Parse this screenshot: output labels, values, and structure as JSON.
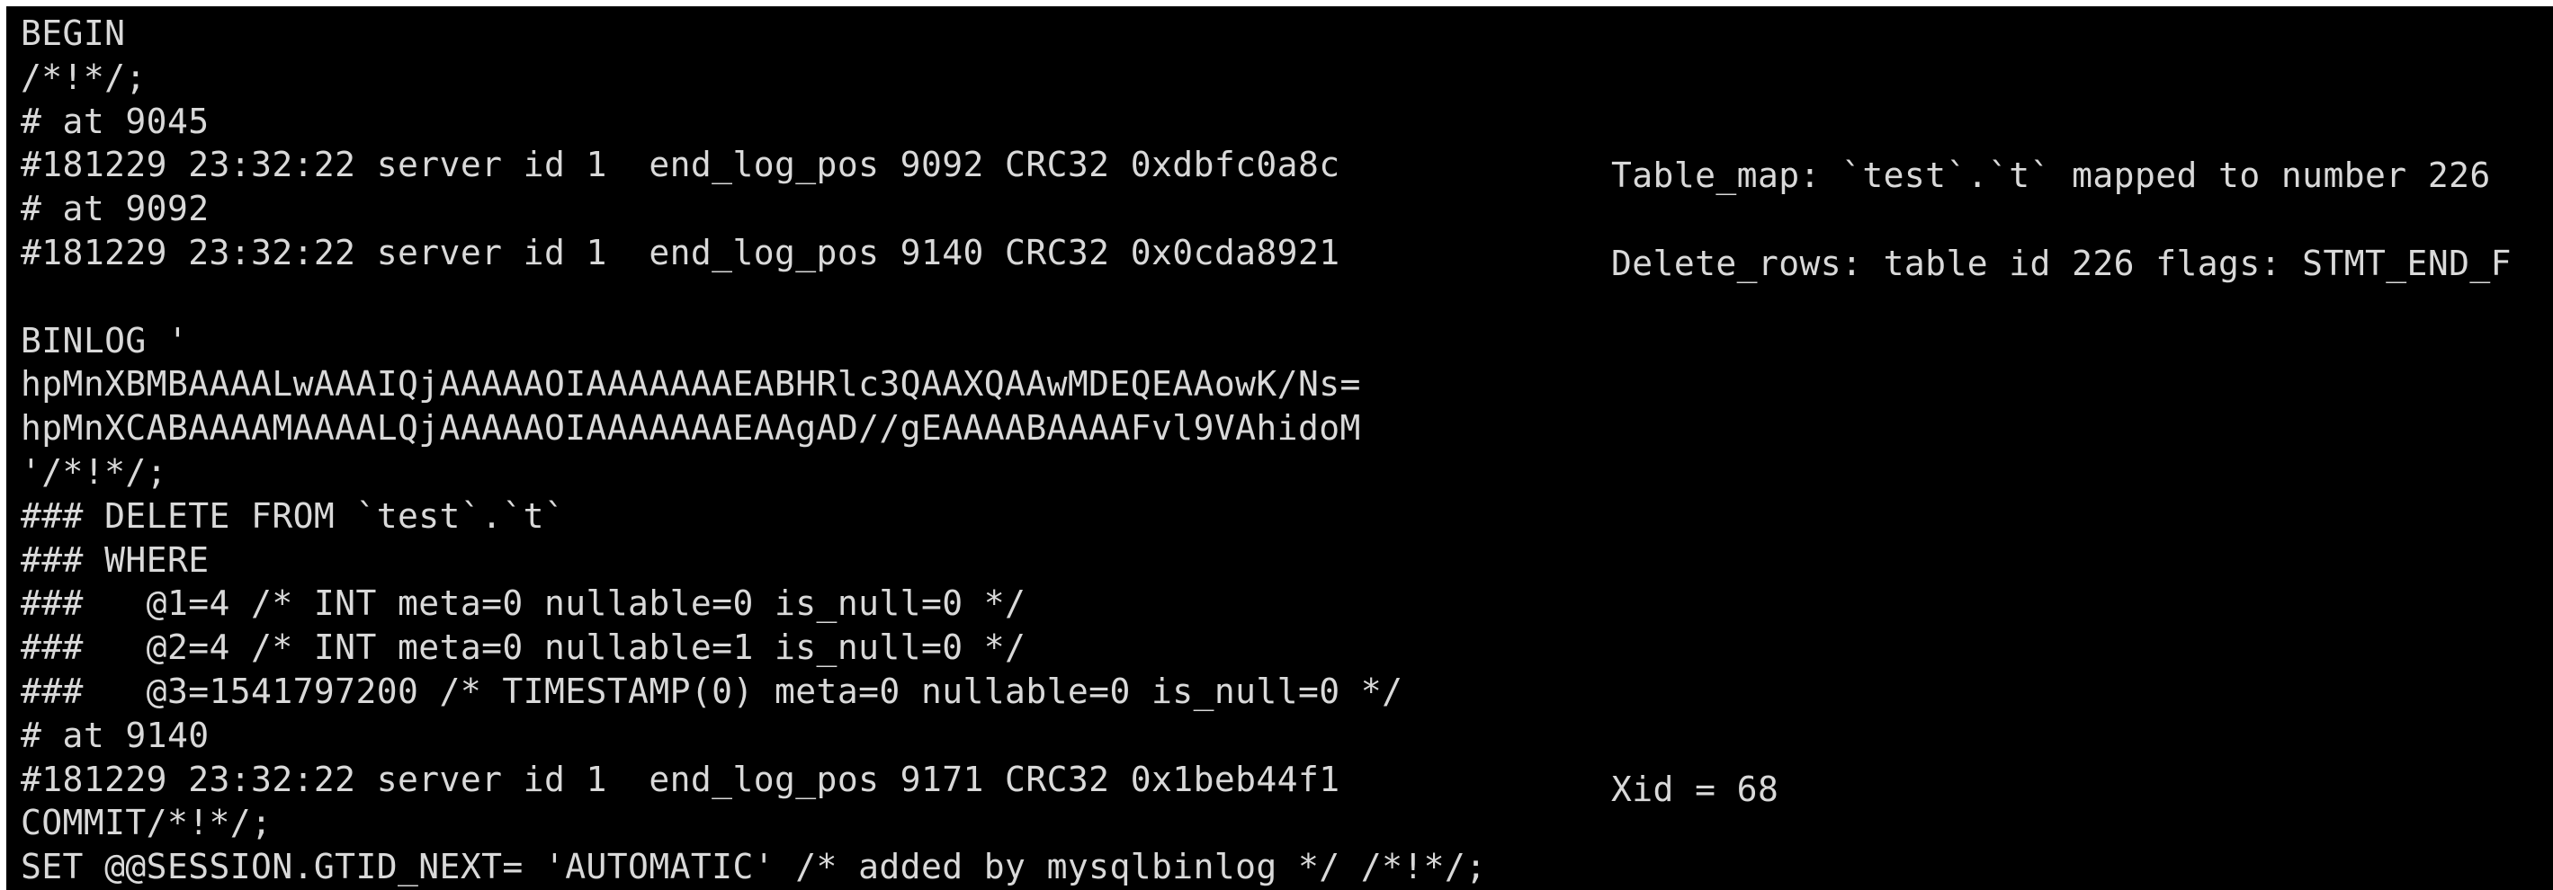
{
  "terminal": {
    "lines": [
      {
        "left": "BEGIN",
        "right": ""
      },
      {
        "left": "/*!*/;",
        "right": ""
      },
      {
        "left": "# at 9045",
        "right": ""
      },
      {
        "left": "#181229 23:32:22 server id 1  end_log_pos 9092 CRC32 0xdbfc0a8c",
        "right": "Table_map: `test`.`t` mapped to number 226"
      },
      {
        "left": "# at 9092",
        "right": ""
      },
      {
        "left": "#181229 23:32:22 server id 1  end_log_pos 9140 CRC32 0x0cda8921",
        "right": "Delete_rows: table id 226 flags: STMT_END_F"
      },
      {
        "left": "",
        "right": ""
      },
      {
        "left": "BINLOG '",
        "right": ""
      },
      {
        "left": "hpMnXBMBAAAALwAAAIQjAAAAAOIAAAAAAAEABHRlc3QAAXQAAwMDEQEAAowK/Ns=",
        "right": ""
      },
      {
        "left": "hpMnXCABAAAAMAAAALQjAAAAAOIAAAAAAAEAAgAD//gEAAAABAAAAFvl9VAhidoM",
        "right": ""
      },
      {
        "left": "'/*!*/;",
        "right": ""
      },
      {
        "left": "### DELETE FROM `test`.`t`",
        "right": ""
      },
      {
        "left": "### WHERE",
        "right": ""
      },
      {
        "left": "###   @1=4 /* INT meta=0 nullable=0 is_null=0 */",
        "right": ""
      },
      {
        "left": "###   @2=4 /* INT meta=0 nullable=1 is_null=0 */",
        "right": ""
      },
      {
        "left": "###   @3=1541797200 /* TIMESTAMP(0) meta=0 nullable=0 is_null=0 */",
        "right": ""
      },
      {
        "left": "# at 9140",
        "right": ""
      },
      {
        "left": "#181229 23:32:22 server id 1  end_log_pos 9171 CRC32 0x1beb44f1",
        "right": "Xid = 68"
      },
      {
        "left": "COMMIT/*!*/;",
        "right": ""
      },
      {
        "left": "SET @@SESSION.GTID_NEXT= 'AUTOMATIC' /* added by mysqlbinlog */ /*!*/;",
        "right": ""
      }
    ]
  },
  "colors": {
    "background": "#000000",
    "text": "#d9d9d9",
    "frame": "#ffffff"
  }
}
